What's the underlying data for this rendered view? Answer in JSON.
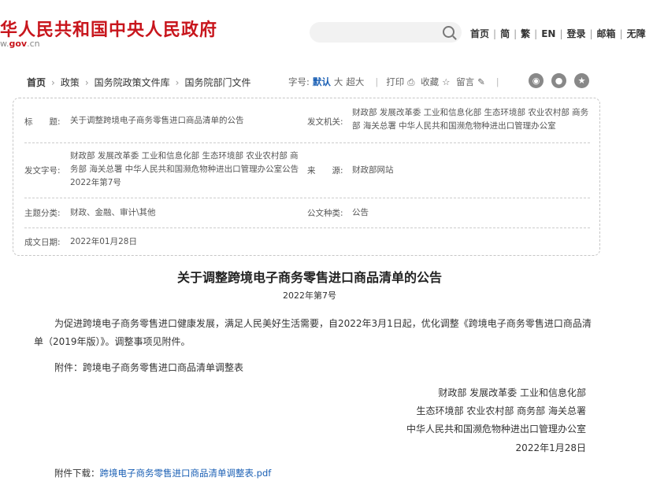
{
  "header": {
    "site_title": "华人民共和国中央人民政府",
    "site_url_prefix": "w.",
    "site_url_gov": "gov",
    "site_url_suffix": ".cn",
    "nav": [
      "首页",
      "简",
      "繁",
      "EN",
      "登录",
      "邮箱",
      "无障"
    ]
  },
  "breadcrumb": [
    "首页",
    "政策",
    "国务院政策文件库",
    "国务院部门文件"
  ],
  "toolbar": {
    "font_size_label": "字号:",
    "font_default": "默认",
    "font_large": "大",
    "font_xlarge": "超大",
    "print_label": "打印",
    "favorite_label": "收藏",
    "comment_label": "留言"
  },
  "meta": {
    "title_label": "标　　题:",
    "title_value": "关于调整跨境电子商务零售进口商品清单的公告",
    "issuer_label": "发文机关:",
    "issuer_value": "财政部 发展改革委 工业和信息化部 生态环境部 农业农村部 商务部 海关总署 中华人民共和国濒危物种进出口管理办公室",
    "docno_label": "发文字号:",
    "docno_value": "财政部 发展改革委 工业和信息化部 生态环境部 农业农村部 商务部 海关总署 中华人民共和国濒危物种进出口管理办公室公告 2022年第7号",
    "source_label": "来　　源:",
    "source_value": "财政部网站",
    "category_label": "主题分类:",
    "category_value": "财政、金融、审计\\其他",
    "type_label": "公文种类:",
    "type_value": "公告",
    "date_label": "成文日期:",
    "date_value": "2022年01月28日"
  },
  "doc": {
    "title": "关于调整跨境电子商务零售进口商品清单的公告",
    "number": "2022年第7号",
    "paragraph": "为促进跨境电子商务零售进口健康发展，满足人民美好生活需要，自2022年3月1日起，优化调整《跨境电子商务零售进口商品清单（2019年版）》。调整事项见附件。",
    "attachment_line": "附件：跨境电子商务零售进口商品清单调整表",
    "signature": [
      "财政部 发展改革委 工业和信息化部",
      "生态环境部 农业农村部 商务部 海关总署",
      "中华人民共和国濒危物种进出口管理办公室",
      "2022年1月28日"
    ],
    "download_label": "附件下载：",
    "download_file": "跨境电子商务零售进口商品清单调整表.pdf"
  }
}
